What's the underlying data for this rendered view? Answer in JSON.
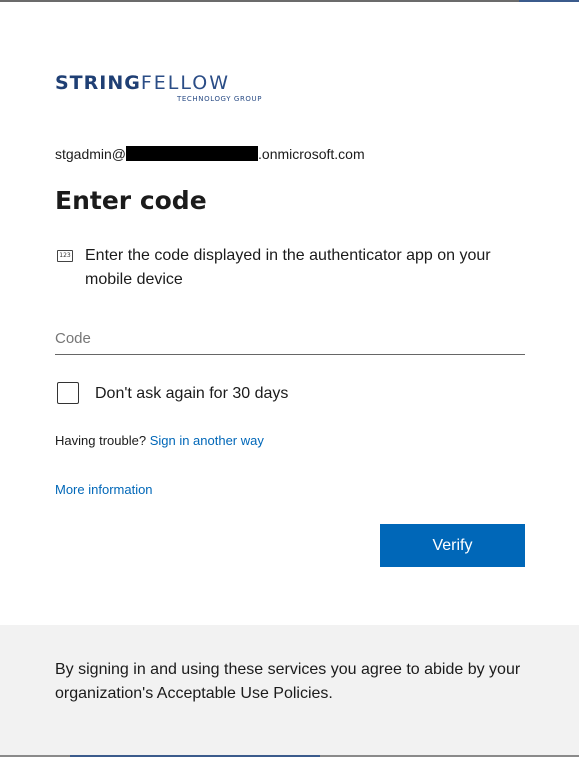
{
  "logo": {
    "word_bold": "STRING",
    "word_thin": "FELLOW",
    "subtitle": "TECHNOLOGY GROUP"
  },
  "identity": {
    "prefix": "stgadmin@",
    "suffix": ".onmicrosoft.com"
  },
  "title": "Enter code",
  "instruction": {
    "icon": "123-keypad-icon",
    "icon_text": "123",
    "text": "Enter the code displayed in the authenticator app on your mobile device"
  },
  "code_field": {
    "placeholder": "Code",
    "value": ""
  },
  "remember": {
    "label": "Don't ask again for 30 days",
    "checked": false
  },
  "trouble": {
    "text": "Having trouble?",
    "link": "Sign in another way"
  },
  "more_info": "More information",
  "verify_label": "Verify",
  "footer": {
    "notice": "By signing in and using these services you agree to abide by your organization's Acceptable Use Policies."
  },
  "colors": {
    "accent": "#0067b8",
    "logo": "#1f3f74",
    "footer_bg": "#f2f2f2"
  }
}
